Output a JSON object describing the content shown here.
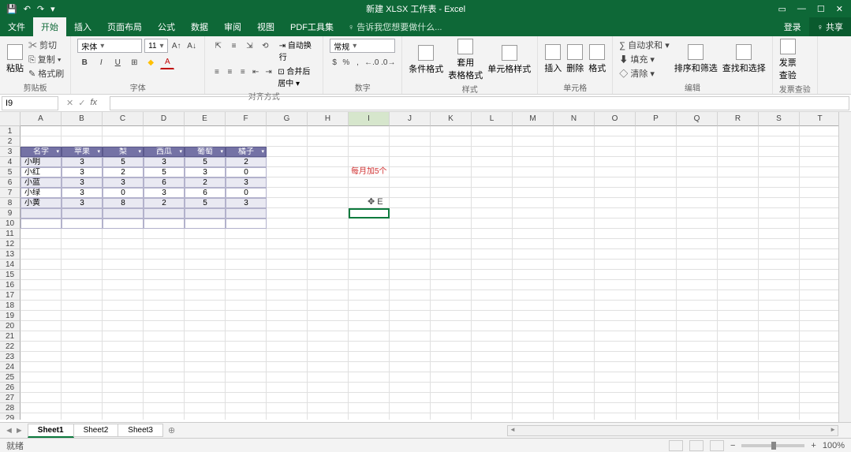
{
  "title": "新建 XLSX 工作表 - Excel",
  "qat": {
    "save": "💾",
    "undo": "↶",
    "redo": "↷",
    "more": "▾"
  },
  "win": {
    "min": "—",
    "max": "☐",
    "close": "✕",
    "ribbon": "▭"
  },
  "tabs": {
    "file": "文件",
    "home": "开始",
    "insert": "插入",
    "layout": "页面布局",
    "formula": "公式",
    "data": "数据",
    "review": "审阅",
    "view": "视图",
    "pdf": "PDF工具集",
    "tell": "♀ 告诉我您想要做什么...",
    "login": "登录",
    "share": "♀ 共享"
  },
  "ribbon": {
    "clipboard": {
      "paste": "粘贴",
      "cut": "✂ 剪切",
      "copy": "⎘ 复制 ▾",
      "painter": "✎ 格式刷",
      "label": "剪贴板"
    },
    "font": {
      "name": "宋体",
      "size": "11",
      "label": "字体",
      "bold": "B",
      "italic": "I",
      "underline": "U",
      "border": "⊞",
      "fill": "◆",
      "color": "A",
      "grow": "A↑",
      "shrink": "A↓"
    },
    "align": {
      "label": "对齐方式",
      "wrap": "⇥ 自动换行",
      "merge": "⊡ 合并后居中 ▾"
    },
    "number": {
      "format": "常规",
      "label": "数字",
      "currency": "$",
      "percent": "%",
      "comma": ",",
      "inc": "←.0",
      "dec": ".0→"
    },
    "styles": {
      "cond": "条件格式",
      "table": "套用\n表格格式",
      "cell": "单元格样式",
      "label": "样式"
    },
    "cells": {
      "insert": "插入",
      "delete": "删除",
      "format": "格式",
      "label": "单元格"
    },
    "editing": {
      "sum": "∑ 自动求和 ▾",
      "fill": "⬇ 填充 ▾",
      "clear": "◇ 清除 ▾",
      "sort": "排序和筛选",
      "find": "查找和选择",
      "label": "编辑"
    },
    "addins": {
      "label": "发票查验",
      "btn": "发票\n查验"
    }
  },
  "namebox": "I9",
  "fx": {
    "cancel": "✕",
    "ok": "✓",
    "fx": "fx"
  },
  "cols": [
    "A",
    "B",
    "C",
    "D",
    "E",
    "F",
    "G",
    "H",
    "I",
    "J",
    "K",
    "L",
    "M",
    "N",
    "O",
    "P",
    "Q",
    "R",
    "S",
    "T"
  ],
  "rows": 29,
  "table": {
    "headers": [
      "名字",
      "苹果",
      "梨",
      "西瓜",
      "葡萄",
      "橘子"
    ],
    "data": [
      [
        "小明",
        "3",
        "5",
        "3",
        "5",
        "2"
      ],
      [
        "小红",
        "3",
        "2",
        "5",
        "3",
        "0"
      ],
      [
        "小蓝",
        "3",
        "3",
        "6",
        "2",
        "3"
      ],
      [
        "小绿",
        "3",
        "0",
        "3",
        "6",
        "0"
      ],
      [
        "小黄",
        "3",
        "8",
        "2",
        "5",
        "3"
      ]
    ]
  },
  "note": "每月加5个",
  "movecursor": "✥ E",
  "sheets": {
    "s1": "Sheet1",
    "s2": "Sheet2",
    "s3": "Sheet3",
    "add": "⊕"
  },
  "status": {
    "ready": "就绪",
    "zoom": "100%",
    "plus": "+",
    "minus": "−"
  },
  "chart_data": {
    "type": "table",
    "title": "每月加5个",
    "columns": [
      "名字",
      "苹果",
      "梨",
      "西瓜",
      "葡萄",
      "橘子"
    ],
    "rows": [
      {
        "名字": "小明",
        "苹果": 3,
        "梨": 5,
        "西瓜": 3,
        "葡萄": 5,
        "橘子": 2
      },
      {
        "名字": "小红",
        "苹果": 3,
        "梨": 2,
        "西瓜": 5,
        "葡萄": 3,
        "橘子": 0
      },
      {
        "名字": "小蓝",
        "苹果": 3,
        "梨": 3,
        "西瓜": 6,
        "葡萄": 2,
        "橘子": 3
      },
      {
        "名字": "小绿",
        "苹果": 3,
        "梨": 0,
        "西瓜": 3,
        "葡萄": 6,
        "橘子": 0
      },
      {
        "名字": "小黄",
        "苹果": 3,
        "梨": 8,
        "西瓜": 2,
        "葡萄": 5,
        "橘子": 3
      }
    ]
  }
}
